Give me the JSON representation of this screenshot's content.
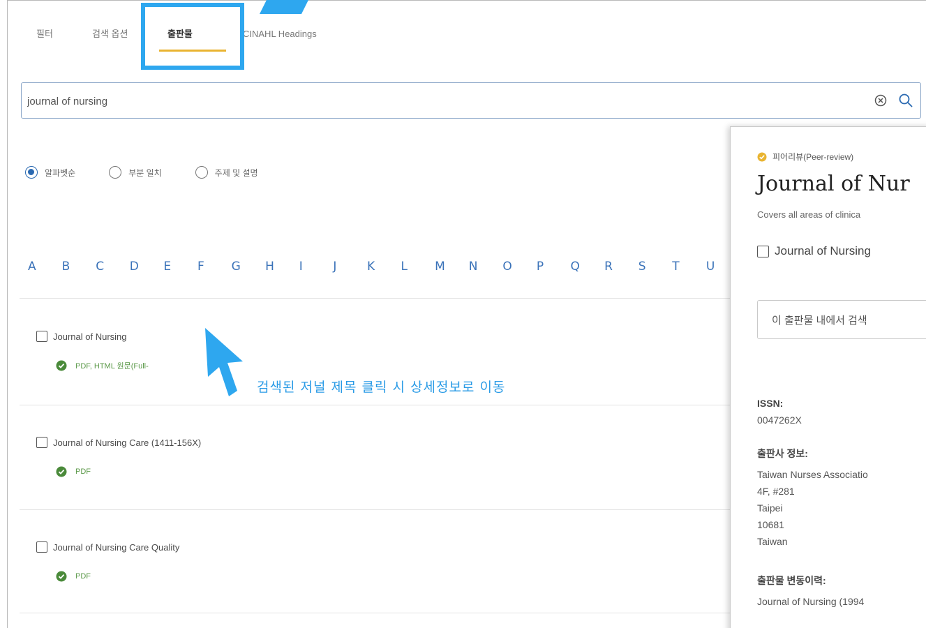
{
  "tabs": [
    {
      "label": "필터"
    },
    {
      "label": "검색 옵션"
    },
    {
      "label": "출판물"
    },
    {
      "label": "CINAHL Headings"
    }
  ],
  "search": {
    "value": "journal of nursing",
    "placeholder": ""
  },
  "radios": [
    {
      "label": "알파벳순",
      "selected": true
    },
    {
      "label": "부분 일치",
      "selected": false
    },
    {
      "label": "주제 및 설명",
      "selected": false
    }
  ],
  "alphabet": [
    "A",
    "B",
    "C",
    "D",
    "E",
    "F",
    "G",
    "H",
    "I",
    "J",
    "K",
    "L",
    "M",
    "N",
    "O",
    "P",
    "Q",
    "R",
    "S",
    "T",
    "U"
  ],
  "results": [
    {
      "title": "Journal of Nursing",
      "fulltext": "PDF, HTML 원문(Full-"
    },
    {
      "title": "Journal of Nursing Care (1411-156X)",
      "fulltext": "PDF"
    },
    {
      "title": "Journal of Nursing Care Quality",
      "fulltext": "PDF"
    }
  ],
  "annotation": {
    "text": "검색된 저널 제목 클릭 시 상세정보로 이동"
  },
  "panel": {
    "peer_review": "피어리뷰(Peer-review)",
    "title": "Journal of Nur",
    "description": "Covers all areas of clinica",
    "checkbox_label": "Journal of Nursing",
    "search_within": "이 출판물 내에서 검색",
    "issn_label": "ISSN:",
    "issn_value": "0047262X",
    "publisher_label": "출판사 정보:",
    "publisher_lines": [
      "Taiwan Nurses Associatio",
      "4F, #281",
      "Taipei",
      "10681",
      "Taiwan"
    ],
    "history_label": "출판물 변동이력:",
    "history_value": "Journal of Nursing (1994"
  },
  "colors": {
    "accent": "#2a69b1",
    "tab_underline": "#e9b431",
    "annotation": "#2ea7ef",
    "fulltext": "#5c9a4a"
  }
}
